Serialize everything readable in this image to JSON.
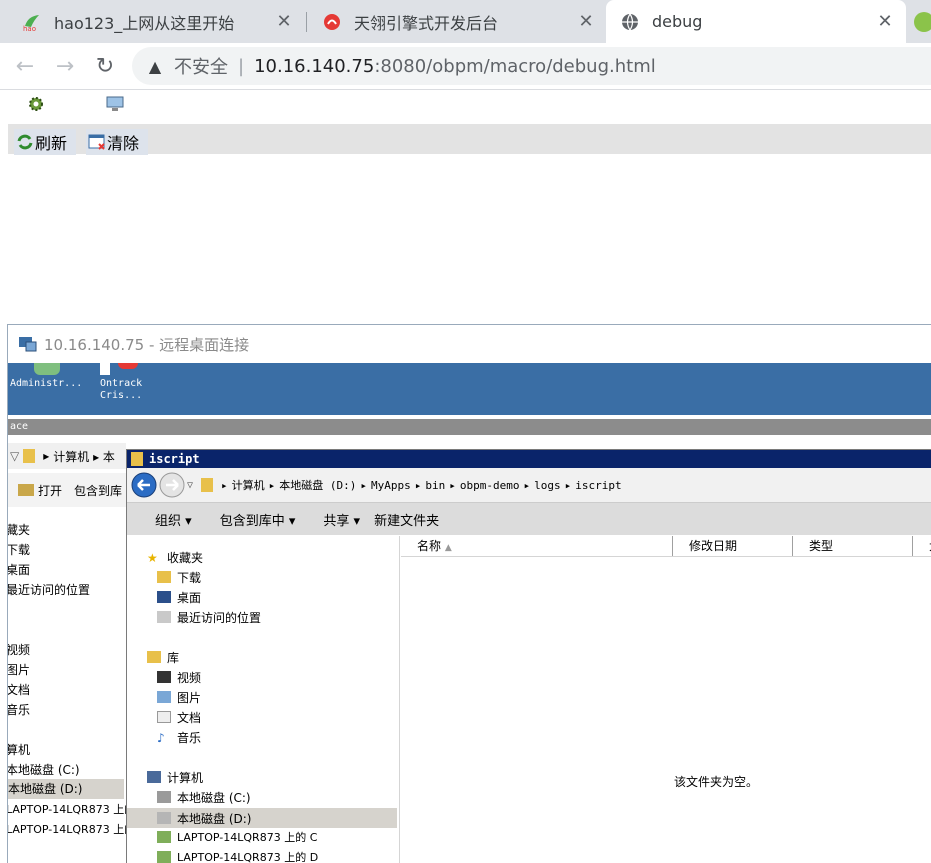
{
  "browser": {
    "tabs": [
      {
        "title": "hao123_上网从这里开始"
      },
      {
        "title": "天翎引擎式开发后台"
      },
      {
        "title": "debug"
      }
    ],
    "address": {
      "security": "不安全",
      "host": "10.16.140.75",
      "path": ":8080/obpm/macro/debug.html"
    }
  },
  "page": {
    "buttons": {
      "refresh": "刷新",
      "clear": "清除"
    }
  },
  "rdp": {
    "title": "10.16.140.75 - 远程桌面连接",
    "desktop_icons": [
      {
        "label": "Administr..."
      },
      {
        "label": "Ontrack Cris..."
      }
    ],
    "gray_strip_text": "ace",
    "back_explorer": {
      "address": "计算机 ▸ 本",
      "open": "打开",
      "include": "包含到库",
      "items": [
        "藏夹",
        "下载",
        "桌面",
        "最近访问的位置",
        "视频",
        "图片",
        "文档",
        "音乐",
        "算机",
        "本地磁盘 (C:)",
        "本地磁盘 (D:)",
        "LAPTOP-14LQR873 上的",
        "LAPTOP-14LQR873 上的"
      ]
    },
    "explorer": {
      "title": "iscript",
      "breadcrumb": [
        "计算机",
        "本地磁盘 (D:)",
        "MyApps",
        "bin",
        "obpm-demo",
        "logs",
        "iscript"
      ],
      "commands": {
        "organize": "组织",
        "include": "包含到库中",
        "share": "共享",
        "new_folder": "新建文件夹"
      },
      "nav": {
        "favorites": "收藏夹",
        "favorite_items": [
          "下载",
          "桌面",
          "最近访问的位置"
        ],
        "libraries": "库",
        "library_items": [
          "视频",
          "图片",
          "文档",
          "音乐"
        ],
        "computer": "计算机",
        "computer_items": [
          "本地磁盘 (C:)",
          "本地磁盘 (D:)",
          "LAPTOP-14LQR873 上的 C",
          "LAPTOP-14LQR873 上的 D"
        ]
      },
      "columns": [
        "名称",
        "修改日期",
        "类型",
        "大"
      ],
      "empty_text": "该文件夹为空。"
    }
  }
}
